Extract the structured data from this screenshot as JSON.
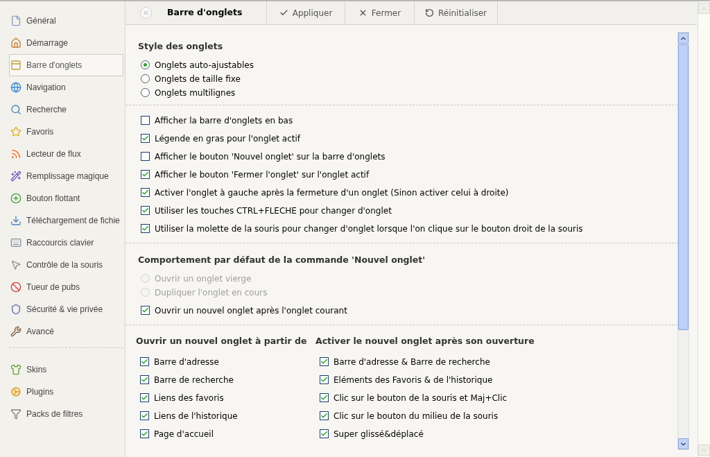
{
  "sidebar": {
    "groups": [
      [
        {
          "label": "Général",
          "selected": false
        },
        {
          "label": "Démarrage",
          "selected": false
        },
        {
          "label": "Barre d'onglets",
          "selected": true
        },
        {
          "label": "Navigation",
          "selected": false
        },
        {
          "label": "Recherche",
          "selected": false
        },
        {
          "label": "Favoris",
          "selected": false
        },
        {
          "label": "Lecteur de flux",
          "selected": false
        },
        {
          "label": "Remplissage magique",
          "selected": false
        },
        {
          "label": "Bouton flottant",
          "selected": false
        },
        {
          "label": "Téléchargement de fichie",
          "selected": false
        },
        {
          "label": "Raccourcis clavier",
          "selected": false
        },
        {
          "label": "Contrôle de la souris",
          "selected": false
        },
        {
          "label": "Tueur de pubs",
          "selected": false
        },
        {
          "label": "Sécurité & vie privée",
          "selected": false
        },
        {
          "label": "Avancé",
          "selected": false
        }
      ],
      [
        {
          "label": "Skins",
          "selected": false
        },
        {
          "label": "Plugins",
          "selected": false
        },
        {
          "label": "Packs de filtres",
          "selected": false
        }
      ]
    ]
  },
  "toolbar": {
    "title": "Barre d'onglets",
    "buttons": [
      {
        "kind": "apply",
        "label": "Appliquer"
      },
      {
        "kind": "close",
        "label": "Fermer"
      },
      {
        "kind": "reset",
        "label": "Réinitialiser"
      }
    ]
  },
  "sections": [
    {
      "kind": "list",
      "title": "Style des onglets",
      "groups": [
        [
          {
            "kind": "radio",
            "label": "Onglets auto-ajustables",
            "selected": true,
            "disabled": false
          },
          {
            "kind": "radio",
            "label": "Onglets de taille fixe",
            "selected": false,
            "disabled": false
          },
          {
            "kind": "radio",
            "label": "Onglets multilignes",
            "selected": false,
            "disabled": false
          }
        ]
      ]
    },
    {
      "kind": "list",
      "groups": [
        [
          {
            "kind": "checkbox",
            "label": "Afficher la barre d'onglets en bas",
            "checked": false
          },
          {
            "kind": "checkbox",
            "label": "Légende en gras pour l'onglet actif",
            "checked": true
          },
          {
            "kind": "checkbox",
            "label": "Afficher le bouton 'Nouvel onglet' sur la barre d'onglets",
            "checked": false
          },
          {
            "kind": "checkbox",
            "label": "Afficher le bouton 'Fermer l'onglet' sur l'onglet actif",
            "checked": true
          },
          {
            "kind": "checkbox",
            "label": "Activer l'onglet à gauche après la fermeture d'un onglet (Sinon activer celui à droite)",
            "checked": true
          },
          {
            "kind": "checkbox",
            "label": "Utiliser les touches CTRL+FLECHE pour changer d'onglet",
            "checked": true
          },
          {
            "kind": "checkbox",
            "label": "Utiliser la molette de la souris pour changer d'onglet lorsque l'on clique sur le bouton droit de la souris",
            "checked": true
          }
        ]
      ]
    },
    {
      "kind": "list",
      "title": "Comportement par défaut de la commande 'Nouvel onglet'",
      "groups": [
        [
          {
            "kind": "radio",
            "label": "Ouvrir un onglet vierge",
            "selected": false,
            "disabled": true
          },
          {
            "kind": "radio",
            "label": "Dupliquer l'onglet en cours",
            "selected": false,
            "disabled": true
          }
        ],
        [
          {
            "kind": "checkbox",
            "label": "Ouvrir un nouvel onglet après l'onglet courant",
            "checked": true
          }
        ]
      ]
    },
    {
      "kind": "columns",
      "columns": [
        {
          "title": "Ouvrir un nouvel onglet à partir de",
          "items": [
            {
              "kind": "checkbox",
              "label": "Barre d'adresse",
              "checked": true
            },
            {
              "kind": "checkbox",
              "label": "Barre de recherche",
              "checked": true
            },
            {
              "kind": "checkbox",
              "label": "Liens des favoris",
              "checked": true
            },
            {
              "kind": "checkbox",
              "label": "Liens de l'historique",
              "checked": true
            },
            {
              "kind": "checkbox",
              "label": "Page d'accueil",
              "checked": true
            }
          ]
        },
        {
          "title": "Activer le nouvel onglet après son ouverture",
          "items": [
            {
              "kind": "checkbox",
              "label": "Barre d'adresse & Barre de recherche",
              "checked": true
            },
            {
              "kind": "checkbox",
              "label": "Eléments des Favoris & de l'historique",
              "checked": true
            },
            {
              "kind": "checkbox",
              "label": "Clic sur le bouton de la souris et Maj+Clic",
              "checked": true
            },
            {
              "kind": "checkbox",
              "label": "Clic sur le bouton du milieu de la souris",
              "checked": true
            },
            {
              "kind": "checkbox",
              "label": "Super glissé&déplacé",
              "checked": true
            }
          ]
        }
      ]
    }
  ]
}
